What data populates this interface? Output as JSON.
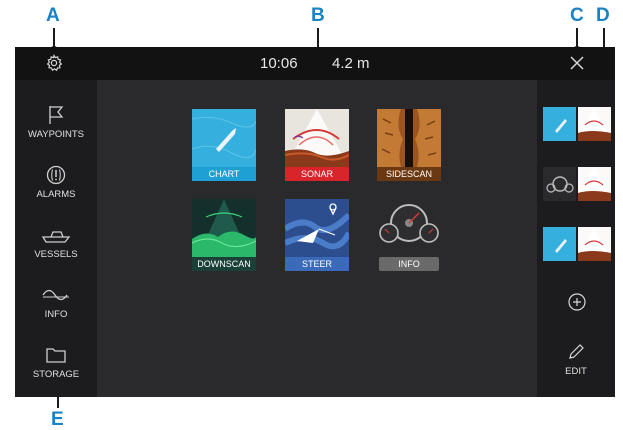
{
  "callouts": [
    "A",
    "B",
    "C",
    "D",
    "E"
  ],
  "status": {
    "time": "10:06",
    "depth": "4.2 m"
  },
  "sidebar": {
    "items": [
      {
        "label": "WAYPOINTS",
        "icon": "flag-icon"
      },
      {
        "label": "ALARMS",
        "icon": "alarm-icon"
      },
      {
        "label": "VESSELS",
        "icon": "boat-icon"
      },
      {
        "label": "INFO",
        "icon": "wave-icon"
      },
      {
        "label": "STORAGE",
        "icon": "folder-icon"
      }
    ]
  },
  "apps": {
    "tiles": [
      {
        "label": "CHART",
        "color": "#2fa8d8"
      },
      {
        "label": "SONAR",
        "color": "#d8242b"
      },
      {
        "label": "SIDESCAN",
        "color": "#8a4a1a"
      },
      {
        "label": "DOWNSCAN",
        "color": "#1d4a44"
      },
      {
        "label": "STEER",
        "color": "#3a6ab8"
      },
      {
        "label": "INFO",
        "color": "#6a6a6a"
      }
    ]
  },
  "rightbar": {
    "favorites": [
      {
        "icon": "chart-sonar-split-icon"
      },
      {
        "icon": "gauge-sonar-split-icon"
      },
      {
        "icon": "chart-sonar-split-icon"
      }
    ],
    "add_icon": "add-icon",
    "edit_label": "EDIT"
  }
}
